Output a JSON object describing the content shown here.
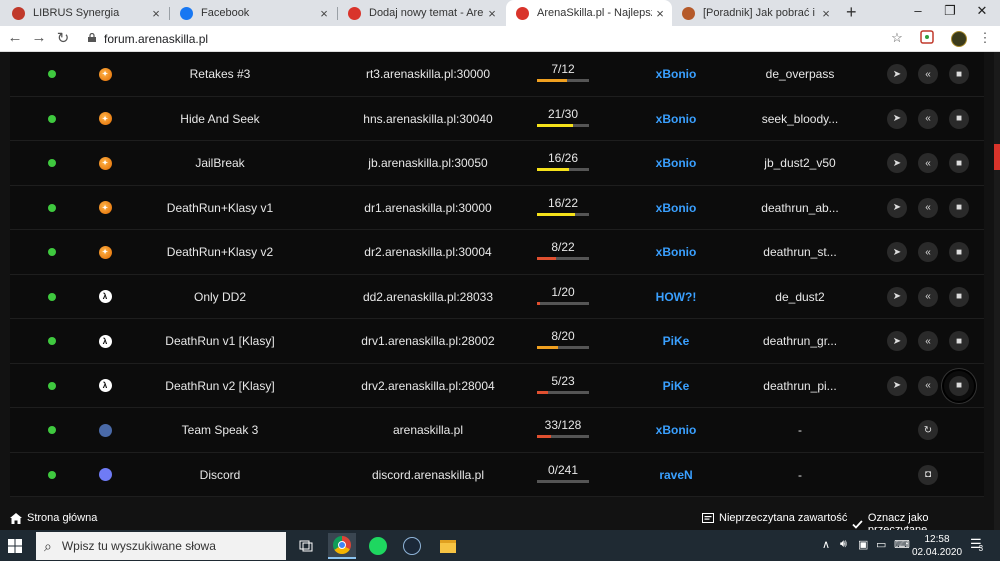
{
  "browser": {
    "tabs": [
      {
        "title": "LIBRUS Synergia",
        "favicon_color": "#c0392b",
        "active": false
      },
      {
        "title": "Facebook",
        "favicon_color": "#1877f2",
        "active": false
      },
      {
        "title": "Dodaj nowy temat - ArenaSkill",
        "favicon_color": "#d9342b",
        "active": false
      },
      {
        "title": "ArenaSkilla.pl - Najlepsza Sieć",
        "favicon_color": "#d9342b",
        "active": true
      },
      {
        "title": "[Poradnik] Jak pobrać i włączy",
        "favicon_color": "#b55a2a",
        "active": false
      }
    ],
    "new_tab_label": "+",
    "close_label": "×",
    "window_controls": {
      "minimize": "–",
      "maximize": "❐",
      "close": "✕"
    },
    "url": "forum.arenaskilla.pl",
    "nav": {
      "back": "←",
      "forward": "→",
      "reload": "↻"
    },
    "star": "☆",
    "menu": "⋮"
  },
  "servers": [
    {
      "game_icon": "cs-icon",
      "name": "Retakes #3",
      "address": "rt3.arenaskilla.pl:30000",
      "players": "7/12",
      "fill": 0.58,
      "bar_color": "#f0a020",
      "admin": "xBonio",
      "admin_color": "#3aa0ff",
      "map": "de_overpass",
      "actions": [
        "steam-icon",
        "gametracker-icon",
        "record-icon"
      ]
    },
    {
      "game_icon": "cs-icon",
      "name": "Hide And Seek",
      "address": "hns.arenaskilla.pl:30040",
      "players": "21/30",
      "fill": 0.7,
      "bar_color": "#f5e11a",
      "admin": "xBonio",
      "admin_color": "#3aa0ff",
      "map": "seek_bloody...",
      "actions": [
        "steam-icon",
        "gametracker-icon",
        "record-icon"
      ]
    },
    {
      "game_icon": "cs-icon",
      "name": "JailBreak",
      "address": "jb.arenaskilla.pl:30050",
      "players": "16/26",
      "fill": 0.62,
      "bar_color": "#f5e11a",
      "admin": "xBonio",
      "admin_color": "#3aa0ff",
      "map": "jb_dust2_v50",
      "actions": [
        "steam-icon",
        "gametracker-icon",
        "record-icon"
      ]
    },
    {
      "game_icon": "cs-icon",
      "name": "DeathRun+Klasy v1",
      "address": "dr1.arenaskilla.pl:30000",
      "players": "16/22",
      "fill": 0.73,
      "bar_color": "#f5e11a",
      "admin": "xBonio",
      "admin_color": "#3aa0ff",
      "map": "deathrun_ab...",
      "actions": [
        "steam-icon",
        "gametracker-icon",
        "record-icon"
      ]
    },
    {
      "game_icon": "cs-icon",
      "name": "DeathRun+Klasy v2",
      "address": "dr2.arenaskilla.pl:30004",
      "players": "8/22",
      "fill": 0.36,
      "bar_color": "#e05030",
      "admin": "xBonio",
      "admin_color": "#3aa0ff",
      "map": "deathrun_st...",
      "actions": [
        "steam-icon",
        "gametracker-icon",
        "record-icon"
      ]
    },
    {
      "game_icon": "cs-white-icon",
      "name": "Only DD2",
      "address": "dd2.arenaskilla.pl:28033",
      "players": "1/20",
      "fill": 0.05,
      "bar_color": "#e05030",
      "admin": "HOW?!",
      "admin_color": "#3aa0ff",
      "map": "de_dust2",
      "actions": [
        "steam-icon",
        "gametracker-icon",
        "record-icon"
      ]
    },
    {
      "game_icon": "cs-white-icon",
      "name": "DeathRun v1 [Klasy]",
      "address": "drv1.arenaskilla.pl:28002",
      "players": "8/20",
      "fill": 0.4,
      "bar_color": "#f0a020",
      "admin": "PiKe",
      "admin_color": "#3aa0ff",
      "map": "deathrun_gr...",
      "actions": [
        "steam-icon",
        "gametracker-icon",
        "record-icon"
      ]
    },
    {
      "game_icon": "cs-white-icon",
      "name": "DeathRun v2 [Klasy]",
      "address": "drv2.arenaskilla.pl:28004",
      "players": "5/23",
      "fill": 0.22,
      "bar_color": "#e05030",
      "admin": "PiKe",
      "admin_color": "#3aa0ff",
      "map": "deathrun_pi...",
      "actions": [
        "steam-icon",
        "gametracker-icon",
        "record-icon"
      ],
      "highlight_last": true
    },
    {
      "game_icon": "teamspeak-icon",
      "name": "Team Speak 3",
      "address": "arenaskilla.pl",
      "players": "33/128",
      "fill": 0.26,
      "bar_color": "#e05030",
      "admin": "xBonio",
      "admin_color": "#3aa0ff",
      "map": "-",
      "actions": [
        "teamspeak-connect-icon"
      ]
    },
    {
      "game_icon": "discord-icon",
      "name": "Discord",
      "address": "discord.arenaskilla.pl",
      "players": "0/241",
      "fill": 0.0,
      "bar_color": "#e05030",
      "admin": "raveN",
      "admin_color": "#3aa0ff",
      "map": "-",
      "actions": [
        "discord-connect-icon"
      ]
    }
  ],
  "footer": {
    "home": "Strona główna",
    "unread": "Nieprzeczytana zawartość",
    "mark_read": "Oznacz jako przeczytane"
  },
  "taskbar": {
    "search_placeholder": "Wpisz tu wyszukiwane słowa",
    "time": "12:58",
    "date": "02.04.2020",
    "notification_count": "3"
  }
}
